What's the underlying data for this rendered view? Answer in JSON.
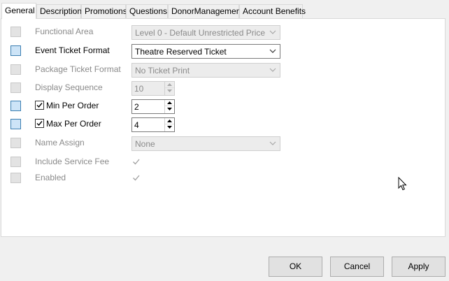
{
  "tabs": [
    {
      "label": "General",
      "active": true
    },
    {
      "label": "Description",
      "active": false
    },
    {
      "label": "Promotions",
      "active": false
    },
    {
      "label": "Questions",
      "active": false
    },
    {
      "label": "DonorManagement",
      "active": false
    },
    {
      "label": "Account Benefits",
      "active": false
    }
  ],
  "fields": {
    "functional_area": {
      "label": "Functional Area",
      "value": "Level 0 - Default Unrestricted Price",
      "enabled": false
    },
    "event_ticket_format": {
      "label": "Event Ticket Format",
      "value": "Theatre Reserved Ticket",
      "enabled": true
    },
    "package_ticket_format": {
      "label": "Package Ticket Format",
      "value": "No Ticket Print",
      "enabled": false
    },
    "display_sequence": {
      "label": "Display Sequence",
      "value": "10",
      "enabled": false
    },
    "min_per_order": {
      "label": "Min Per Order",
      "value": "2",
      "checked": true,
      "enabled": true
    },
    "max_per_order": {
      "label": "Max Per Order",
      "value": "4",
      "checked": true,
      "enabled": true
    },
    "name_assign": {
      "label": "Name Assign",
      "value": "None",
      "enabled": false
    },
    "include_service_fee": {
      "label": "Include Service Fee",
      "checked": true,
      "enabled": false
    },
    "enabled": {
      "label": "Enabled",
      "checked": true,
      "enabled": false
    }
  },
  "buttons": {
    "ok": "OK",
    "cancel": "Cancel",
    "apply": "Apply"
  },
  "colors": {
    "panel_bg": "#ffffff",
    "window_bg": "#f0f0f0",
    "indicator_active": "#cde4f7",
    "indicator_inactive": "#e3e3e3",
    "disabled_text": "#8a8a8a"
  }
}
